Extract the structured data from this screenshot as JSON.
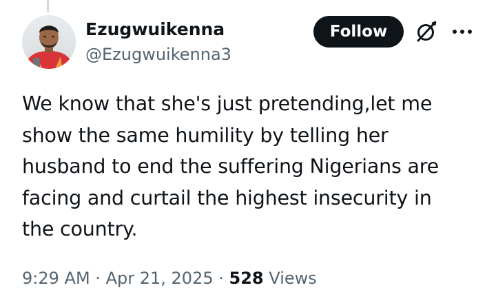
{
  "author": {
    "display_name": "Ezugwuikenna",
    "handle": "@Ezugwuikenna3"
  },
  "actions": {
    "follow_label": "Follow",
    "grok_icon": "grok-icon",
    "more_icon": "more-icon"
  },
  "tweet": {
    "lines": [
      "We know that she's just pretending,let me",
      "show the same humility by telling her",
      "husband to end the suffering Nigerians are",
      "facing and curtail the highest insecurity in",
      "the country."
    ]
  },
  "meta": {
    "time": "9:29 AM",
    "separator": "·",
    "date": "Apr 21, 2025",
    "views_count": "528",
    "views_label": "Views"
  },
  "colors": {
    "text_primary": "#0f1419",
    "text_secondary": "#536471",
    "follow_bg": "#0f1419",
    "thread_line": "#cfd9de"
  }
}
